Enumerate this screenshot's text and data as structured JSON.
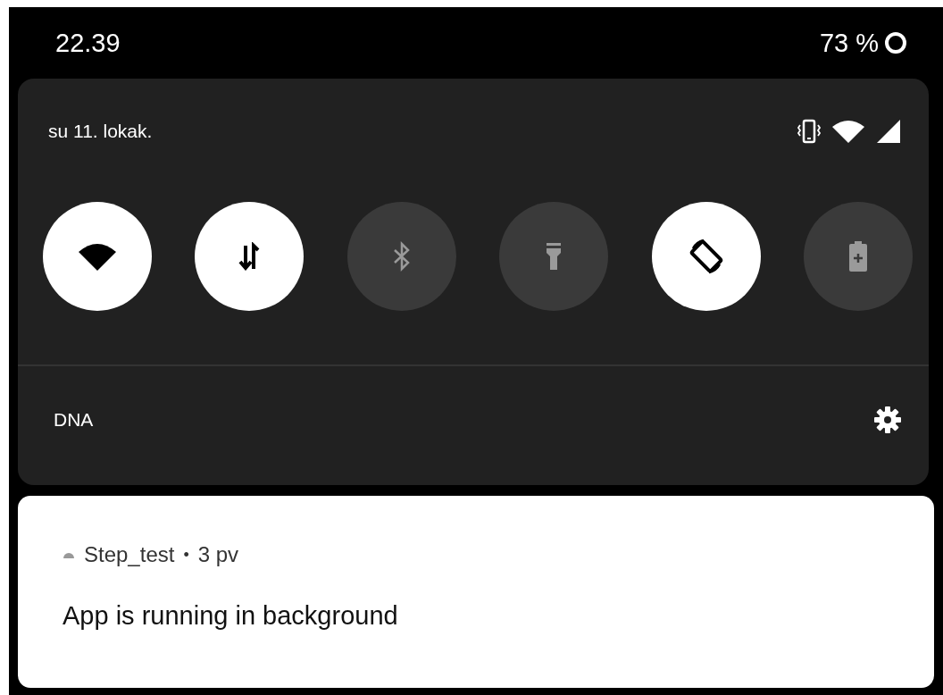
{
  "status_bar": {
    "time": "22.39",
    "battery": "73 %"
  },
  "quick_settings": {
    "date": "su 11. lokak.",
    "tiles": [
      {
        "kind": "wifi",
        "on": true
      },
      {
        "kind": "data",
        "on": true
      },
      {
        "kind": "bluetooth",
        "on": false
      },
      {
        "kind": "flashlight",
        "on": false
      },
      {
        "kind": "rotate",
        "on": true
      },
      {
        "kind": "battery-saver",
        "on": false
      }
    ],
    "network": "DNA"
  },
  "notification": {
    "app": "Step_test",
    "separator": "•",
    "time": "3 pv",
    "title": "App is running in background"
  }
}
